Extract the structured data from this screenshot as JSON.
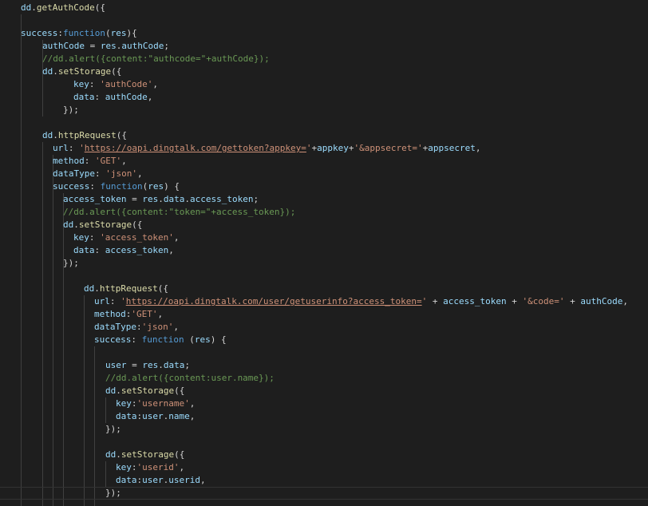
{
  "palette": {
    "background": "#1e1e1e",
    "default": "#d4d4d4",
    "variable": "#9cdcfe",
    "function": "#dcdcaa",
    "keyword": "#569cd6",
    "string": "#ce9178",
    "comment": "#6a9955",
    "indent_guide": "#404040"
  },
  "editor": {
    "lines": [
      [
        [
          "var",
          "dd"
        ],
        [
          "default",
          "."
        ],
        [
          "func",
          "getAuthCode"
        ],
        [
          "default",
          "({"
        ]
      ],
      [],
      [
        [
          "var",
          "success"
        ],
        [
          "default",
          ":"
        ],
        [
          "keyword",
          "function"
        ],
        [
          "default",
          "("
        ],
        [
          "var",
          "res"
        ],
        [
          "default",
          "){"
        ]
      ],
      [
        [
          "var",
          "authCode"
        ],
        [
          "default",
          " = "
        ],
        [
          "var",
          "res"
        ],
        [
          "default",
          "."
        ],
        [
          "var",
          "authCode"
        ],
        [
          "default",
          ";"
        ]
      ],
      [
        [
          "comment",
          "//dd.alert({content:\"authcode=\"+authCode});"
        ]
      ],
      [
        [
          "var",
          "dd"
        ],
        [
          "default",
          "."
        ],
        [
          "func",
          "setStorage"
        ],
        [
          "default",
          "({"
        ]
      ],
      [
        [
          "var",
          "key"
        ],
        [
          "default",
          ": "
        ],
        [
          "string",
          "'authCode'"
        ],
        [
          "default",
          ","
        ]
      ],
      [
        [
          "var",
          "data"
        ],
        [
          "default",
          ": "
        ],
        [
          "var",
          "authCode"
        ],
        [
          "default",
          ","
        ]
      ],
      [
        [
          "default",
          "});"
        ]
      ],
      [],
      [
        [
          "var",
          "dd"
        ],
        [
          "default",
          "."
        ],
        [
          "func",
          "httpRequest"
        ],
        [
          "default",
          "({"
        ]
      ],
      [
        [
          "var",
          "url"
        ],
        [
          "default",
          ": "
        ],
        [
          "string",
          "'"
        ],
        [
          "link",
          "https://oapi.dingtalk.com/gettoken?appkey="
        ],
        [
          "string",
          "'"
        ],
        [
          "default",
          "+"
        ],
        [
          "var",
          "appkey"
        ],
        [
          "default",
          "+"
        ],
        [
          "string",
          "'&appsecret='"
        ],
        [
          "default",
          "+"
        ],
        [
          "var",
          "appsecret"
        ],
        [
          "default",
          ","
        ]
      ],
      [
        [
          "var",
          "method"
        ],
        [
          "default",
          ": "
        ],
        [
          "string",
          "'GET'"
        ],
        [
          "default",
          ","
        ]
      ],
      [
        [
          "var",
          "dataType"
        ],
        [
          "default",
          ": "
        ],
        [
          "string",
          "'json'"
        ],
        [
          "default",
          ","
        ]
      ],
      [
        [
          "var",
          "success"
        ],
        [
          "default",
          ": "
        ],
        [
          "keyword",
          "function"
        ],
        [
          "default",
          "("
        ],
        [
          "var",
          "res"
        ],
        [
          "default",
          ") {"
        ]
      ],
      [
        [
          "var",
          "access_token"
        ],
        [
          "default",
          " = "
        ],
        [
          "var",
          "res"
        ],
        [
          "default",
          "."
        ],
        [
          "var",
          "data"
        ],
        [
          "default",
          "."
        ],
        [
          "var",
          "access_token"
        ],
        [
          "default",
          ";"
        ]
      ],
      [
        [
          "comment",
          "//dd.alert({content:\"token=\"+access_token});"
        ]
      ],
      [
        [
          "var",
          "dd"
        ],
        [
          "default",
          "."
        ],
        [
          "func",
          "setStorage"
        ],
        [
          "default",
          "({"
        ]
      ],
      [
        [
          "var",
          "key"
        ],
        [
          "default",
          ": "
        ],
        [
          "string",
          "'access_token'"
        ],
        [
          "default",
          ","
        ]
      ],
      [
        [
          "var",
          "data"
        ],
        [
          "default",
          ": "
        ],
        [
          "var",
          "access_token"
        ],
        [
          "default",
          ","
        ]
      ],
      [
        [
          "default",
          "});"
        ]
      ],
      [],
      [
        [
          "var",
          "dd"
        ],
        [
          "default",
          "."
        ],
        [
          "func",
          "httpRequest"
        ],
        [
          "default",
          "({"
        ]
      ],
      [
        [
          "var",
          "url"
        ],
        [
          "default",
          ": "
        ],
        [
          "string",
          "'"
        ],
        [
          "link",
          "https://oapi.dingtalk.com/user/getuserinfo?access_token="
        ],
        [
          "string",
          "'"
        ],
        [
          "default",
          " + "
        ],
        [
          "var",
          "access_token"
        ],
        [
          "default",
          " + "
        ],
        [
          "string",
          "'&code='"
        ],
        [
          "default",
          " + "
        ],
        [
          "var",
          "authCode"
        ],
        [
          "default",
          ","
        ]
      ],
      [
        [
          "var",
          "method"
        ],
        [
          "default",
          ":"
        ],
        [
          "string",
          "'GET'"
        ],
        [
          "default",
          ","
        ]
      ],
      [
        [
          "var",
          "dataType"
        ],
        [
          "default",
          ":"
        ],
        [
          "string",
          "'json'"
        ],
        [
          "default",
          ","
        ]
      ],
      [
        [
          "var",
          "success"
        ],
        [
          "default",
          ": "
        ],
        [
          "keyword",
          "function"
        ],
        [
          "default",
          " ("
        ],
        [
          "var",
          "res"
        ],
        [
          "default",
          ") {"
        ]
      ],
      [],
      [
        [
          "var",
          "user"
        ],
        [
          "default",
          " = "
        ],
        [
          "var",
          "res"
        ],
        [
          "default",
          "."
        ],
        [
          "var",
          "data"
        ],
        [
          "default",
          ";"
        ]
      ],
      [
        [
          "comment",
          "//dd.alert({content:user.name});"
        ]
      ],
      [
        [
          "var",
          "dd"
        ],
        [
          "default",
          "."
        ],
        [
          "func",
          "setStorage"
        ],
        [
          "default",
          "({"
        ]
      ],
      [
        [
          "var",
          "key"
        ],
        [
          "default",
          ":"
        ],
        [
          "string",
          "'username'"
        ],
        [
          "default",
          ","
        ]
      ],
      [
        [
          "var",
          "data"
        ],
        [
          "default",
          ":"
        ],
        [
          "var",
          "user"
        ],
        [
          "default",
          "."
        ],
        [
          "var",
          "name"
        ],
        [
          "default",
          ","
        ]
      ],
      [
        [
          "default",
          "});"
        ]
      ],
      [],
      [
        [
          "var",
          "dd"
        ],
        [
          "default",
          "."
        ],
        [
          "func",
          "setStorage"
        ],
        [
          "default",
          "({"
        ]
      ],
      [
        [
          "var",
          "key"
        ],
        [
          "default",
          ":"
        ],
        [
          "string",
          "'userid'"
        ],
        [
          "default",
          ","
        ]
      ],
      [
        [
          "var",
          "data"
        ],
        [
          "default",
          ":"
        ],
        [
          "var",
          "user"
        ],
        [
          "default",
          "."
        ],
        [
          "var",
          "userid"
        ],
        [
          "default",
          ","
        ]
      ],
      [
        [
          "default",
          "});"
        ]
      ]
    ]
  }
}
